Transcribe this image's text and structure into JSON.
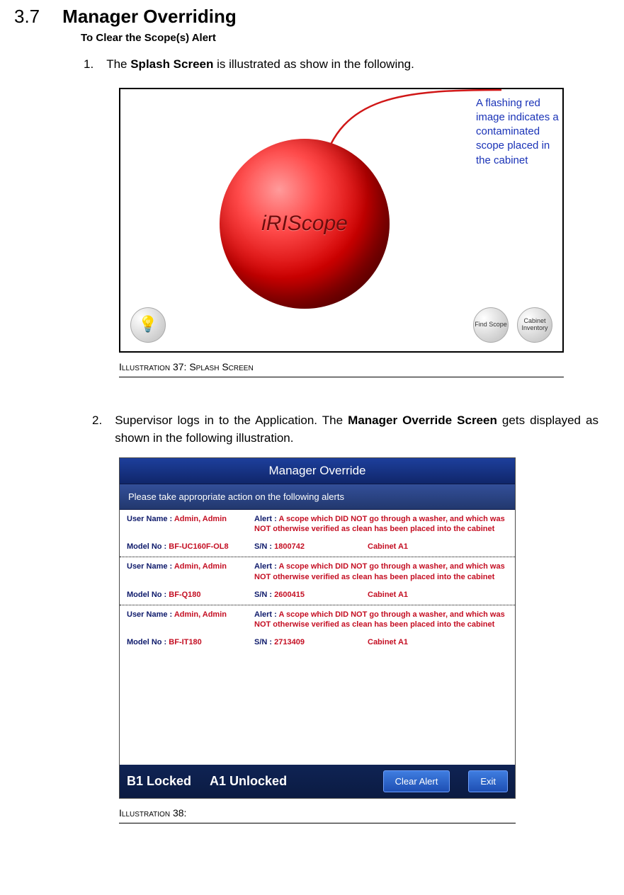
{
  "section": {
    "num": "3.7",
    "title": "Manager Overriding"
  },
  "subhead": "To Clear the Scope(s) Alert",
  "step1": {
    "num": "1.",
    "pre": "The ",
    "bold": "Splash Screen",
    "post": " is illustrated as show in the following."
  },
  "splash": {
    "sphere_text": "iRIScope",
    "callout": "A flashing red image indicates a contaminated scope placed in the cabinet",
    "find_btn": "Find Scope",
    "inv_btn": "Cabinet Inventory"
  },
  "caption37": {
    "word1": "Illustration ",
    "num": "37",
    "colon": ": ",
    "rest": "Splash Screen"
  },
  "step2": {
    "num": "2.",
    "pre": "Supervisor logs in to the Application. The ",
    "bold": "Manager Override Screen",
    "post": " gets displayed as shown in the following illustration."
  },
  "mo": {
    "title": "Manager Override",
    "subtitle": "Please take appropriate action on the following alerts",
    "alert_msg": "A scope which DID NOT go through a washer, and which was NOT otherwise verified  as clean has been placed into the cabinet",
    "labels": {
      "user": "User Name : ",
      "alert": "Alert : ",
      "model": "Model No : ",
      "sn": "S/N : "
    },
    "alerts": [
      {
        "user": "Admin, Admin",
        "model": "BF-UC160F-OL8",
        "sn": "1800742",
        "cabinet": "Cabinet A1"
      },
      {
        "user": "Admin, Admin",
        "model": "BF-Q180",
        "sn": "2600415",
        "cabinet": "Cabinet A1"
      },
      {
        "user": "Admin, Admin",
        "model": "BF-IT180",
        "sn": "2713409",
        "cabinet": "Cabinet A1"
      }
    ],
    "footer": {
      "left": "B1 Locked",
      "mid": "A1 Unlocked",
      "clear": "Clear Alert",
      "exit": "Exit"
    }
  },
  "caption38": {
    "word1": "Illustration ",
    "num": "38",
    "colon": ":"
  }
}
